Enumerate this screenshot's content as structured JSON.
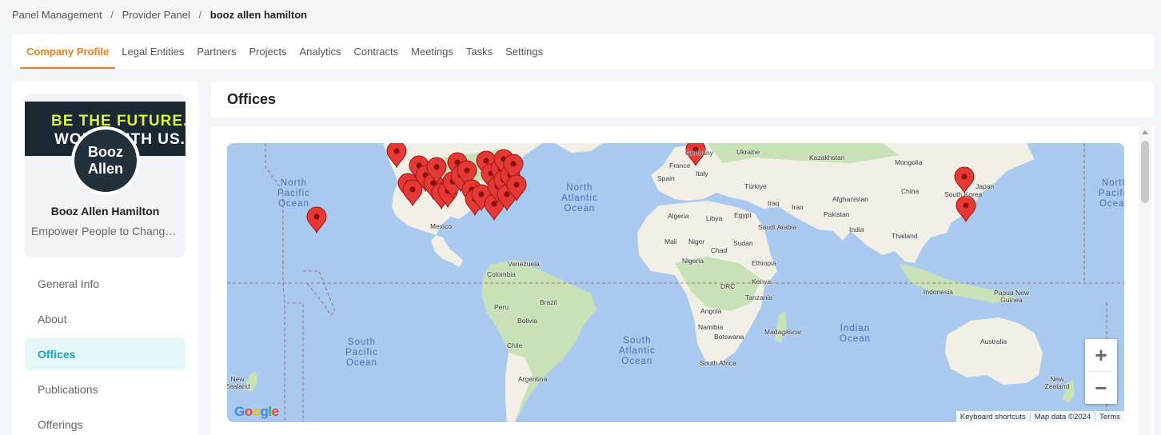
{
  "breadcrumb": {
    "item1": "Panel Management",
    "item2": "Provider Panel",
    "current": "booz allen hamilton",
    "separator": "/"
  },
  "tabs": [
    "Company Profile",
    "Legal Entities",
    "Partners",
    "Projects",
    "Analytics",
    "Contracts",
    "Meetings",
    "Tasks",
    "Settings"
  ],
  "active_tab": "Company Profile",
  "profile": {
    "banner_line1": "BE THE FUTURE.",
    "banner_line2": "WORK WITH US.",
    "logo_line1": "Booz",
    "logo_line2": "Allen",
    "name": "Booz Allen Hamilton",
    "tagline": "Empower People to Change the World"
  },
  "side_nav": [
    "General Info",
    "About",
    "Offices",
    "Publications",
    "Offerings"
  ],
  "active_side": "Offices",
  "section_title": "Offices",
  "map": {
    "oceans": {
      "north_pacific_left": [
        "North",
        "Pacific",
        "Ocean"
      ],
      "north_atlantic": [
        "North",
        "Atlantic",
        "Ocean"
      ],
      "north_pacific_right": [
        "North",
        "Pacific",
        "Ocean"
      ],
      "south_pacific": [
        "South",
        "Pacific",
        "Ocean"
      ],
      "south_atlantic": [
        "South",
        "Atlantic",
        "Ocean"
      ],
      "indian": [
        "Indian",
        "Ocean"
      ]
    },
    "labels": {
      "germany": "Germany",
      "ukraine": "Ukraine",
      "kazakhstan": "Kazakhstan",
      "mongolia": "Mongolia",
      "france": "France",
      "italy": "Italy",
      "spain": "Spain",
      "turkiye": "Türkiye",
      "china": "China",
      "japan": "Japan",
      "south_korea": "South Korea",
      "iraq": "Iraq",
      "iran": "Iran",
      "afghanistan": "Afghanistan",
      "pakistan": "Pakistan",
      "algeria": "Algeria",
      "libya": "Libya",
      "egypt": "Egypt",
      "saudi_arabia": "Saudi Arabia",
      "india": "India",
      "thailand": "Thailand",
      "mexico": "Mexico",
      "mali": "Mali",
      "niger": "Niger",
      "chad": "Chad",
      "sudan": "Sudan",
      "nigeria": "Nigeria",
      "ethiopia": "Ethiopia",
      "venezuela": "Venezuela",
      "colombia": "Colombia",
      "kenya": "Kenya",
      "drc": "DRC",
      "tanzania": "Tanzania",
      "indonesia": "Indonesia",
      "png": "Papua New Guinea",
      "peru": "Peru",
      "brazil": "Brazil",
      "bolivia": "Bolivia",
      "angola": "Angola",
      "namibia": "Namibia",
      "madagascar": "Madagascar",
      "botswana": "Botswana",
      "chile": "Chile",
      "south_africa": "South Africa",
      "australia": "Australia",
      "argentina": "Argentina",
      "nz_left": "New Zealand",
      "nz_right": "New Zealand"
    },
    "zoom_in": "+",
    "zoom_out": "−",
    "google": "Google",
    "attribution": [
      "Keyboard shortcuts",
      "Map data ©2024",
      "Terms"
    ],
    "colors": {
      "water": "#a9c9ee",
      "land": "#f1efe6",
      "forest": "#c8e1b6",
      "marker": "#e53935"
    }
  }
}
